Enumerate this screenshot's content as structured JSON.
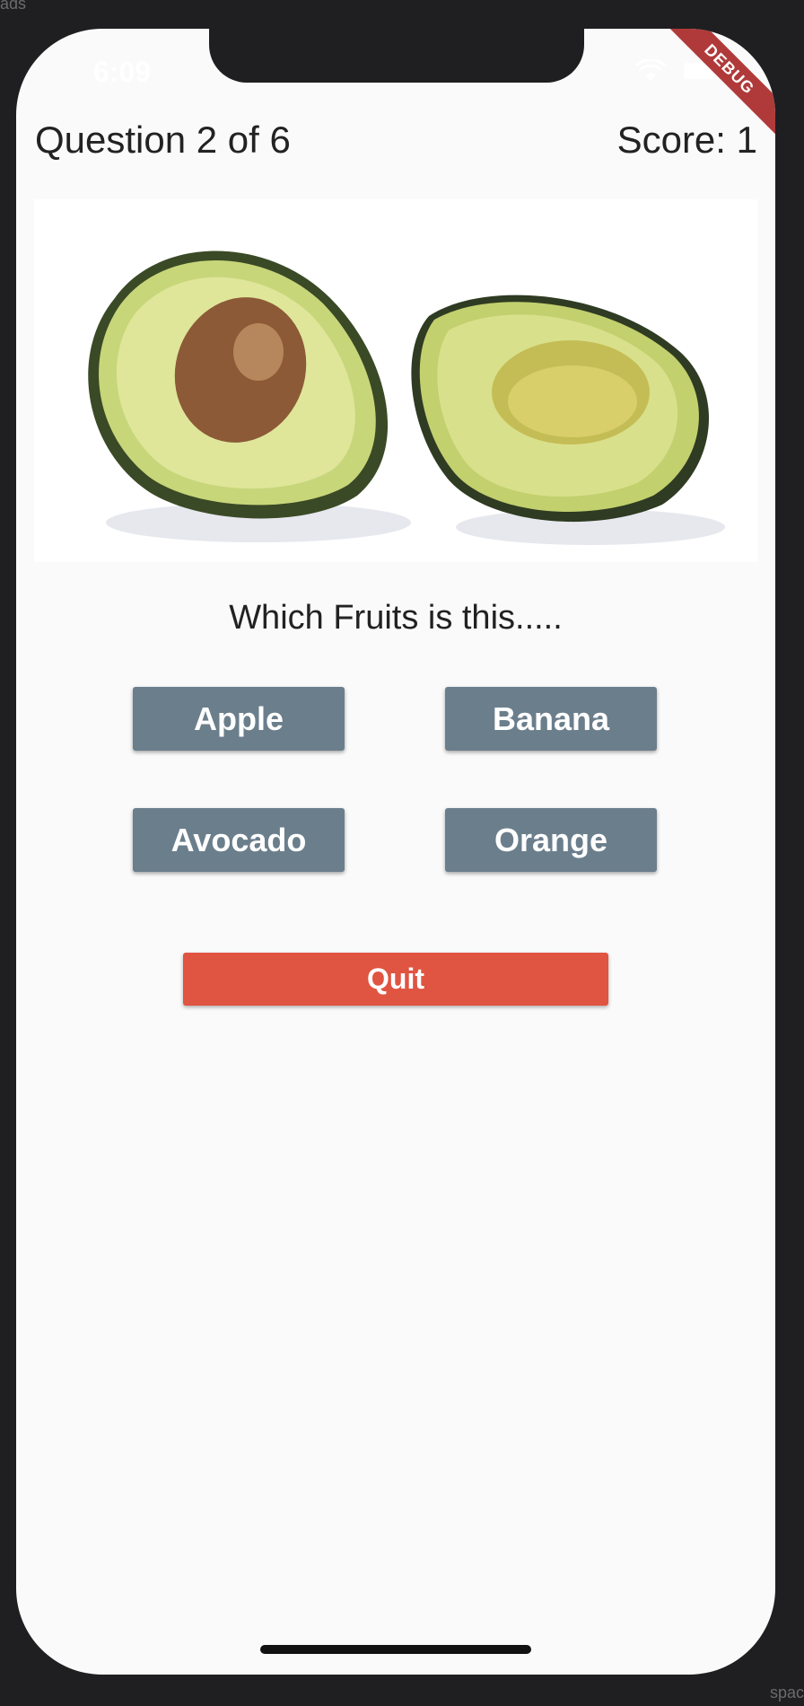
{
  "host": {
    "top_left_text": "ads",
    "bottom_right_text": "spac"
  },
  "status_bar": {
    "time": "6:09",
    "debug_label": "DEBUG",
    "wifi_icon": "wifi-icon",
    "battery_icon": "battery-icon"
  },
  "quiz": {
    "question_counter": "Question 2 of 6",
    "score": "Score: 1",
    "prompt": "Which Fruits is this.....",
    "answers": [
      "Apple",
      "Banana",
      "Avocado",
      "Orange"
    ],
    "quit_label": "Quit"
  },
  "colors": {
    "answer_button": "#6b7e8c",
    "quit_button": "#e05442",
    "background": "#fafafa",
    "debug_banner": "#b03a3a"
  }
}
